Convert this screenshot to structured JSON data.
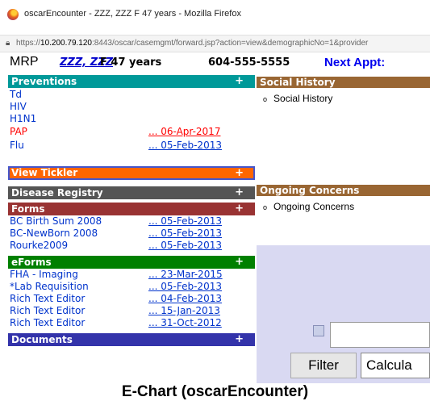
{
  "window": {
    "title": "oscarEncounter - ZZZ, ZZZ F 47 years - Mozilla Firefox"
  },
  "address_bar": {
    "url_prefix": "https://",
    "url_host": "10.200.79.120",
    "url_rest": ":8443/oscar/casemgmt/forward.jsp?action=view&demographicNo=1&provider"
  },
  "patient_bar": {
    "mrp": "MRP",
    "name": "ZZZ, ZZZ",
    "info": "F 47 years",
    "phone": "604-555-5555",
    "next_appt": "Next Appt:"
  },
  "left_nav": {
    "preventions": {
      "title": "Preventions",
      "plus": "+",
      "color": "#009999",
      "items": [
        {
          "label": "Td",
          "date": ""
        },
        {
          "label": "HIV",
          "date": ""
        },
        {
          "label": "H1N1",
          "date": ""
        },
        {
          "label": "PAP",
          "date": "... 06-Apr-2017"
        },
        {
          "label": "Flu",
          "date": "... 05-Feb-2013"
        }
      ]
    },
    "tickler": {
      "title": "View Tickler",
      "plus": "+",
      "color": "#ff6600"
    },
    "disease_registry": {
      "title": "Disease Registry",
      "plus": "+",
      "color": "#555555"
    },
    "forms": {
      "title": "Forms",
      "plus": "+",
      "color": "#993333",
      "items": [
        {
          "label": "BC Birth Sum 2008",
          "date": "... 05-Feb-2013"
        },
        {
          "label": "BC-NewBorn 2008",
          "date": "... 05-Feb-2013"
        },
        {
          "label": "Rourke2009",
          "date": "... 05-Feb-2013"
        }
      ]
    },
    "eforms": {
      "title": "eForms",
      "plus": "+",
      "color": "#008000",
      "items": [
        {
          "label": "FHA - Imaging",
          "date": "... 23-Mar-2015"
        },
        {
          "label": "*Lab Requisition",
          "date": "... 05-Feb-2013"
        },
        {
          "label": "Rich Text Editor",
          "date": "... 04-Feb-2013"
        },
        {
          "label": "Rich Text Editor",
          "date": "... 15-Jan-2013"
        },
        {
          "label": "Rich Text Editor",
          "date": "... 31-Oct-2012"
        }
      ]
    },
    "documents": {
      "title": "Documents",
      "plus": "+",
      "color": "#3333aa"
    }
  },
  "right_panels": {
    "social_history": {
      "title": "Social History",
      "color": "#996633",
      "items": [
        "Social History"
      ]
    },
    "ongoing_concerns": {
      "title": "Ongoing Concerns",
      "color": "#996633",
      "items": [
        "Ongoing Concerns"
      ]
    }
  },
  "search": {
    "filter_label": "Filter",
    "calc_label": "Calcula"
  },
  "caption": "E-Chart (oscarEncounter)"
}
